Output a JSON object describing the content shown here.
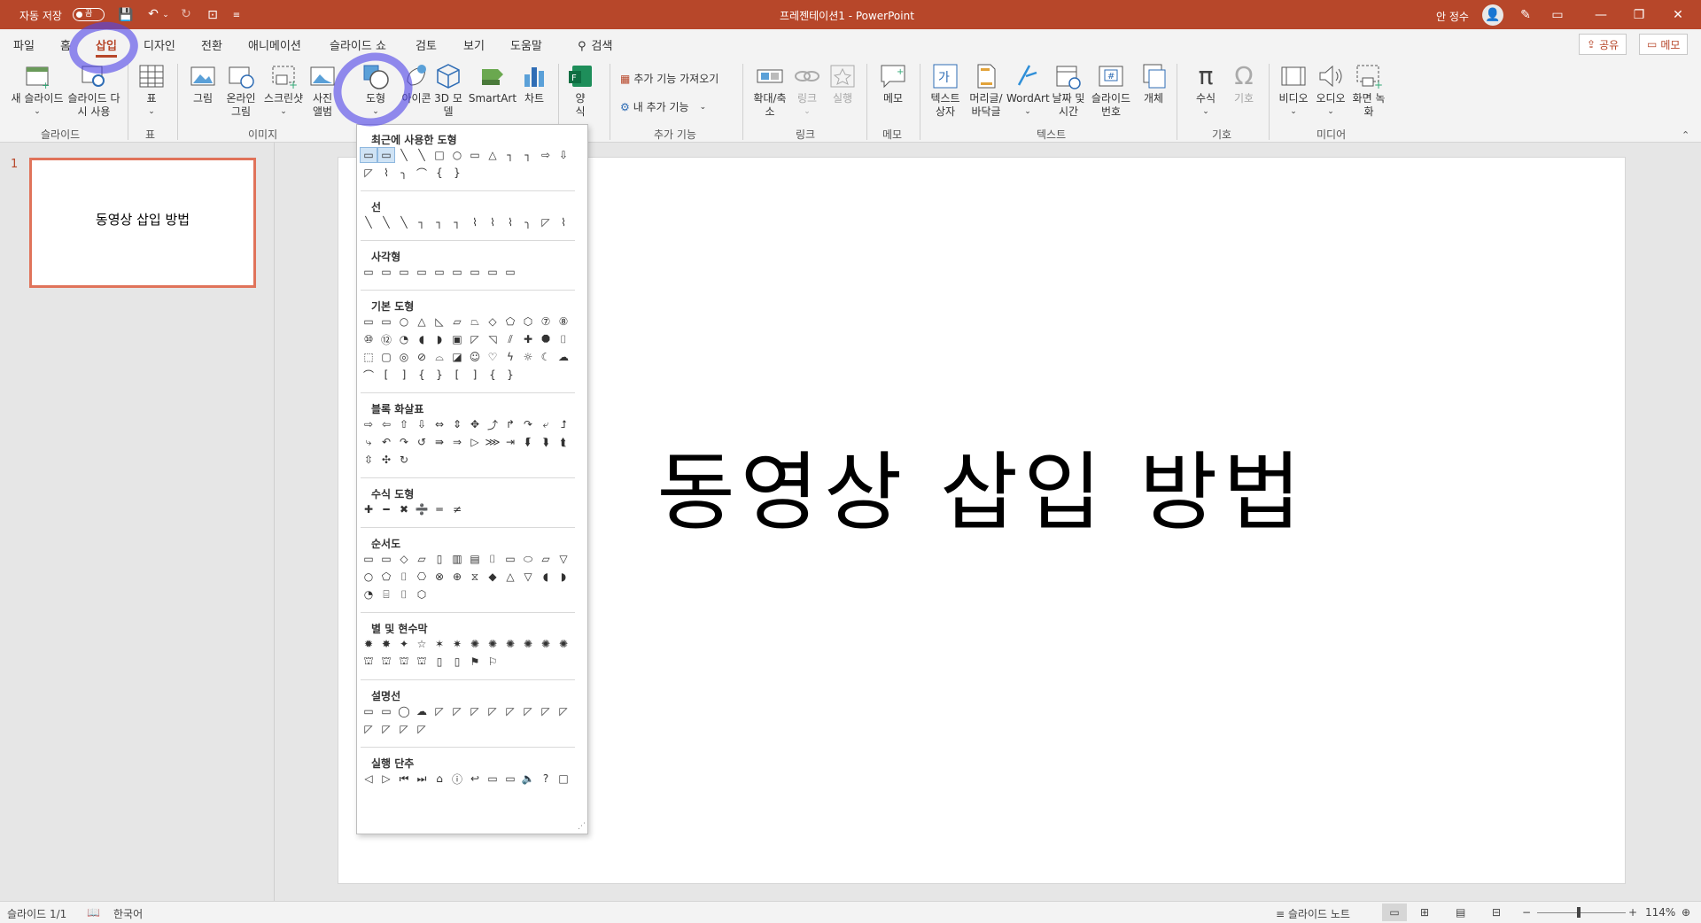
{
  "titlebar": {
    "autosave_label": "자동 저장",
    "autosave_state": "끔",
    "doc_title": "프레젠테이션1 - PowerPoint",
    "user_name": "안 정수"
  },
  "tabs": [
    "파일",
    "홈",
    "삽입",
    "디자인",
    "전환",
    "애니메이션",
    "슬라이드 쇼",
    "검토",
    "보기",
    "도움말"
  ],
  "active_tab": "삽입",
  "search_label": "검색",
  "share_label": "공유",
  "comments_label": "메모",
  "ribbon": {
    "new_slide": "새 슬라이드",
    "reuse_slide": "슬라이드 다시 사용",
    "table": "표",
    "picture": "그림",
    "online_picture": "온라인 그림",
    "screenshot": "스크린샷",
    "photo_album": "사진 앨범",
    "shapes": "도형",
    "icons": "아이콘",
    "models3d": "3D 모델",
    "smartart": "SmartArt",
    "chart": "차트",
    "forms": "양식",
    "get_addins": "추가 기능 가져오기",
    "my_addins": "내 추가 기능",
    "zoom": "확대/축소",
    "link": "링크",
    "action": "실행",
    "comment": "메모",
    "textbox": "텍스트 상자",
    "header_footer": "머리글/바닥글",
    "wordart": "WordArt",
    "date_time": "날짜 및 시간",
    "slide_number": "슬라이드 번호",
    "object": "개체",
    "equation": "수식",
    "symbol": "기호",
    "video": "비디오",
    "audio": "오디오",
    "screen_recording": "화면 녹화"
  },
  "groups": {
    "slides": "슬라이드",
    "tables": "표",
    "images": "이미지",
    "addins": "추가 기능",
    "links": "링크",
    "comments": "메모",
    "text": "텍스트",
    "symbols": "기호",
    "media": "미디어"
  },
  "thumbnail": {
    "number": "1",
    "title": "동영상 삽입 방법"
  },
  "slide": {
    "title": "동영상 삽입 방법"
  },
  "gallery": {
    "sections": [
      {
        "title": "최근에 사용한 도형",
        "rows": [
          [
            "▭",
            "▭",
            "╲",
            "╲",
            "□",
            "○",
            "▭",
            "△",
            "┐",
            "┐",
            "⇨",
            "⇩"
          ],
          [
            "◸",
            "⌇",
            "╮",
            "⌒",
            "{",
            "}"
          ]
        ]
      },
      {
        "title": "선",
        "rows": [
          [
            "╲",
            "╲",
            "╲",
            "┐",
            "┐",
            "┐",
            "⌇",
            "⌇",
            "⌇",
            "╮",
            "◸",
            "⌇"
          ]
        ]
      },
      {
        "title": "사각형",
        "rows": [
          [
            "▭",
            "▭",
            "▭",
            "▭",
            "▭",
            "▭",
            "▭",
            "▭",
            "▭"
          ]
        ]
      },
      {
        "title": "기본 도형",
        "rows": [
          [
            "▭",
            "▭",
            "○",
            "△",
            "◺",
            "▱",
            "⏢",
            "◇",
            "⬠",
            "⬡",
            "⑦",
            "⑧"
          ],
          [
            "⑩",
            "⑫",
            "◔",
            "◖",
            "◗",
            "▣",
            "◸",
            "◹",
            "⫽",
            "✚",
            "⯃",
            "⌷"
          ],
          [
            "⬚",
            "▢",
            "◎",
            "⊘",
            "⌓",
            "◪",
            "☺",
            "♡",
            "ϟ",
            "☼",
            "☾",
            "☁"
          ],
          [
            "⌒",
            "[",
            "]",
            "{",
            "}",
            "[",
            "]",
            "{",
            "}"
          ]
        ]
      },
      {
        "title": "블록 화살표",
        "rows": [
          [
            "⇨",
            "⇦",
            "⇧",
            "⇩",
            "⇔",
            "⇕",
            "✥",
            "⤴",
            "↱",
            "↷",
            "⤶",
            "⮥"
          ],
          [
            "⤷",
            "↶",
            "↷",
            "↺",
            "⇛",
            "⇒",
            "▷",
            "⋙",
            "⇥",
            "⮮",
            "⮯",
            "⮬"
          ],
          [
            "⇳",
            "✣",
            "↻"
          ]
        ]
      },
      {
        "title": "수식 도형",
        "rows": [
          [
            "✚",
            "━",
            "✖",
            "➗",
            "═",
            "≠"
          ]
        ]
      },
      {
        "title": "순서도",
        "rows": [
          [
            "▭",
            "▭",
            "◇",
            "▱",
            "▯",
            "▥",
            "▤",
            "⌷",
            "▭",
            "⬭",
            "⏥",
            "▽"
          ],
          [
            "○",
            "⬠",
            "⌷",
            "⎔",
            "⊗",
            "⊕",
            "⧖",
            "◆",
            "△",
            "▽",
            "◖",
            "◗"
          ],
          [
            "◔",
            "⌸",
            "⌷",
            "⬡"
          ]
        ]
      },
      {
        "title": "별 및 현수막",
        "rows": [
          [
            "✹",
            "✸",
            "✦",
            "☆",
            "✶",
            "✷",
            "✺",
            "✺",
            "✺",
            "✺",
            "✺",
            "✺"
          ],
          [
            "⛫",
            "⛫",
            "⛫",
            "⛫",
            "▯",
            "▯",
            "⚑",
            "⚐"
          ]
        ]
      },
      {
        "title": "설명선",
        "rows": [
          [
            "▭",
            "▭",
            "◯",
            "☁",
            "◸",
            "◸",
            "◸",
            "◸",
            "◸",
            "◸",
            "◸",
            "◸"
          ],
          [
            "◸",
            "◸",
            "◸",
            "◸"
          ]
        ]
      },
      {
        "title": "실행 단추",
        "rows": [
          [
            "◁",
            "▷",
            "⏮",
            "⏭",
            "⌂",
            "ⓘ",
            "↩",
            "▭",
            "▭",
            "🔈",
            "?",
            "□"
          ]
        ]
      }
    ]
  },
  "status": {
    "slide_count": "슬라이드 1/1",
    "language": "한국어",
    "notes": "슬라이드 노트",
    "zoom": "114%"
  }
}
